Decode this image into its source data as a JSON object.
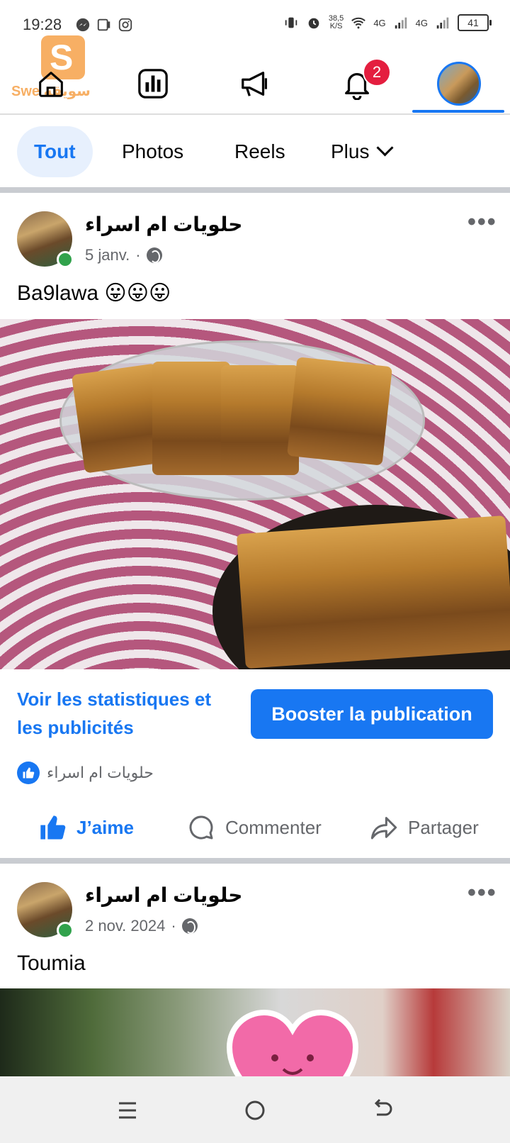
{
  "status_bar": {
    "time": "19:28",
    "net_speed_value": "38,5",
    "net_speed_unit": "K/S",
    "signal1": "4G",
    "signal2": "4G",
    "battery": "41"
  },
  "watermark": {
    "text": "Swe سويقة"
  },
  "topnav": {
    "notifications_badge": "2",
    "items": [
      "home",
      "dashboard",
      "ads",
      "notifications",
      "profile"
    ]
  },
  "filters": {
    "tabs": [
      {
        "label": "Tout",
        "active": true
      },
      {
        "label": "Photos"
      },
      {
        "label": "Reels"
      },
      {
        "label": "Plus"
      }
    ]
  },
  "posts": [
    {
      "author": "حلويات ام اسراء",
      "date": "5 janv.",
      "text": "Ba9lawa 😛😛😛",
      "stats_link": "Voir les statistiques et les publicités",
      "boost_label": "Booster la publication",
      "likes_text": "حلويات ام اسراء",
      "actions": {
        "like": "J’aime",
        "comment": "Commenter",
        "share": "Partager"
      }
    },
    {
      "author": "حلويات ام اسراء",
      "date": "2 nov. 2024",
      "text": "Toumia"
    }
  ],
  "colors": {
    "accent": "#1877f2",
    "badge": "#e41e3f",
    "online": "#31a24c",
    "muted": "#65676b"
  }
}
